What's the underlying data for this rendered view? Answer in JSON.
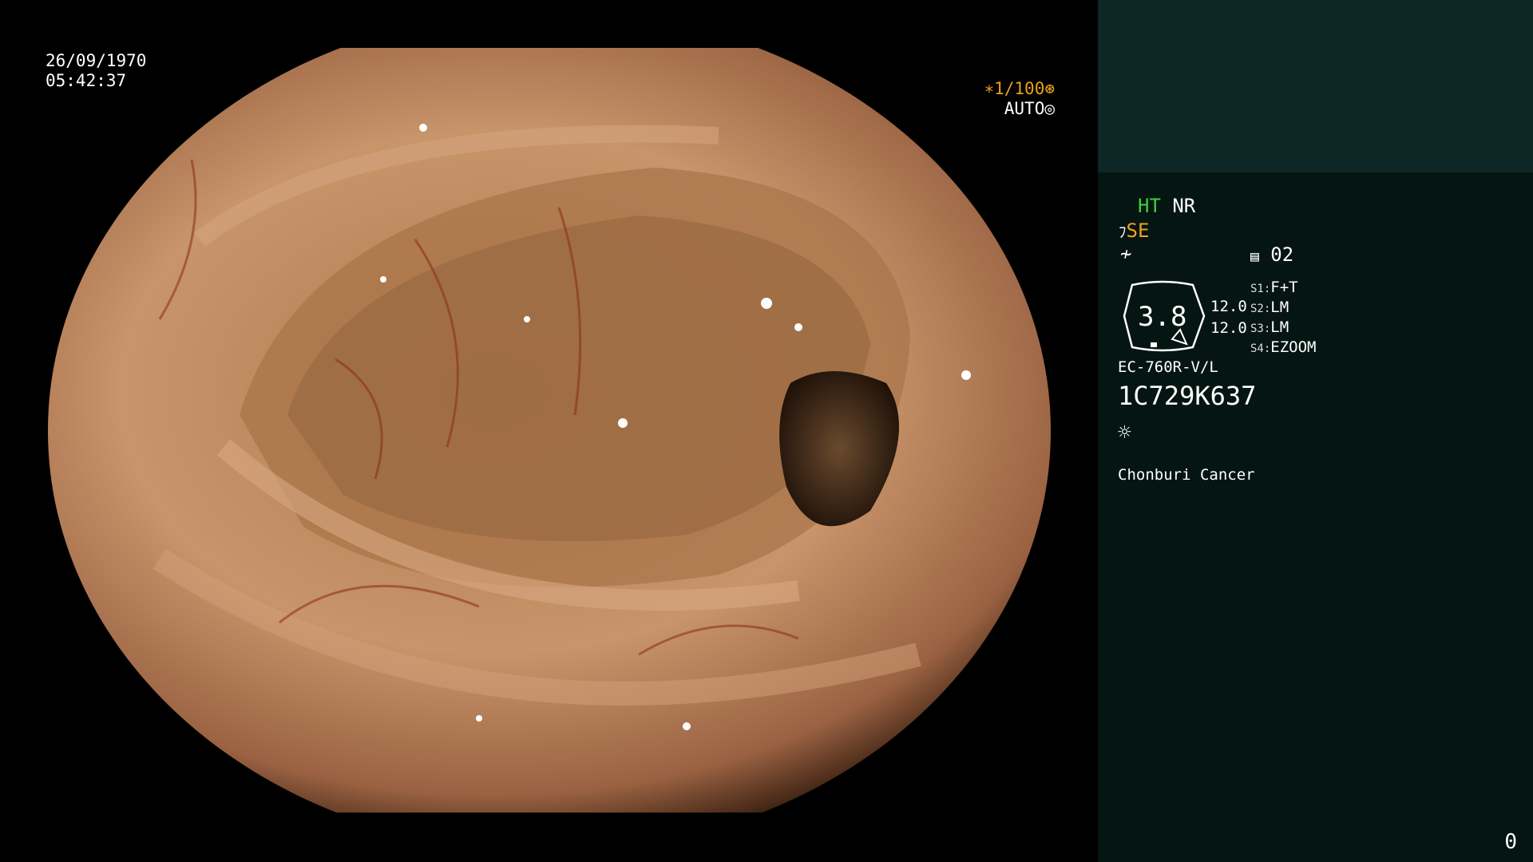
{
  "overlay": {
    "date": "26/09/1970",
    "time": "05:42:37",
    "shutter": "∗1/100",
    "iris": "AUTO"
  },
  "sidebar": {
    "mode_ht": "HT",
    "mode_nr": "NR",
    "se": "SE",
    "memory": "02",
    "zoom_value": "3.8",
    "level_1": "12.0",
    "level_2": "12.0",
    "switches": [
      {
        "key": "S1",
        "value": "F+T"
      },
      {
        "key": "S2",
        "value": "LM"
      },
      {
        "key": "S3",
        "value": "LM"
      },
      {
        "key": "S4",
        "value": "EZOOM"
      }
    ],
    "scope_model": "EC-760R-V/L",
    "serial": "1C729K637",
    "institution": "Chonburi Cancer",
    "counter": "0"
  },
  "icons": [
    "shutter-wheel-icon",
    "iris-icon",
    "scope-icon",
    "filter-icon",
    "memory-icon",
    "light-icon"
  ]
}
